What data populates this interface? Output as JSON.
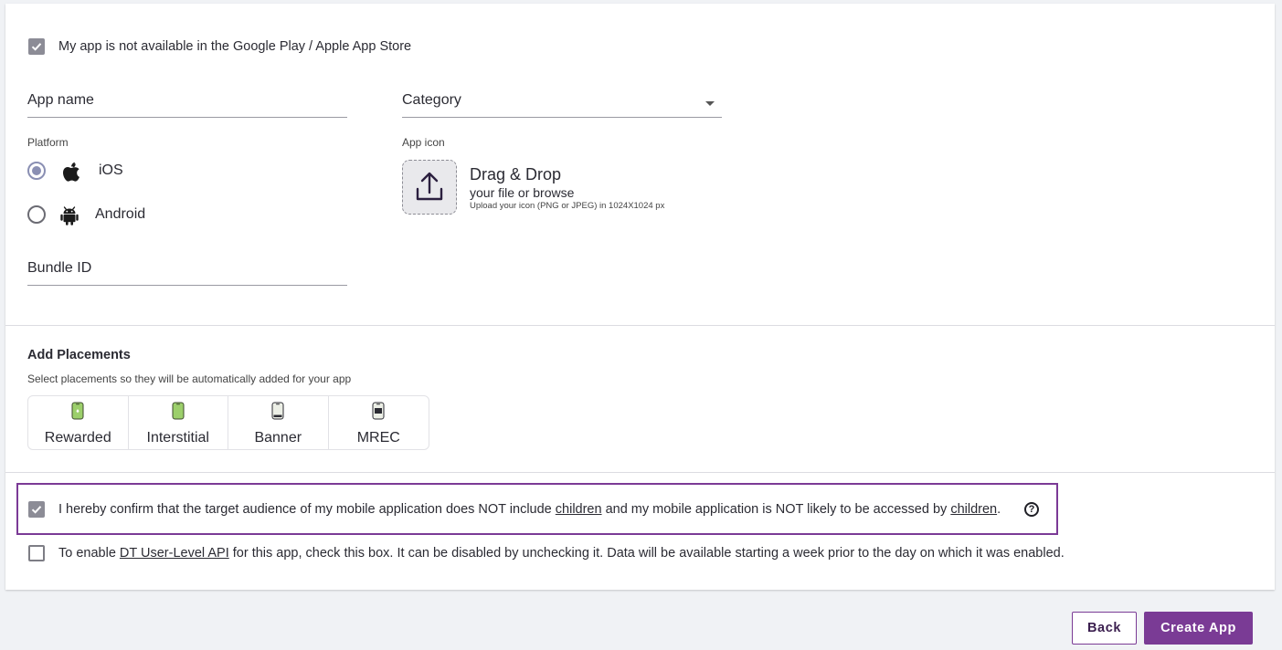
{
  "not_in_store": {
    "label": "My app is not available in the Google Play / Apple App Store",
    "checked": true
  },
  "form": {
    "app_name_label": "App name",
    "category_label": "Category",
    "platform_label": "Platform",
    "platforms": [
      {
        "label": "iOS",
        "icon": "apple-icon",
        "selected": true
      },
      {
        "label": "Android",
        "icon": "android-icon",
        "selected": false
      }
    ],
    "bundle_id_label": "Bundle ID"
  },
  "app_icon": {
    "label": "App icon",
    "title": "Drag & Drop",
    "subtitle": "your file or browse",
    "hint": "Upload your icon (PNG or JPEG) in 1024X1024 px"
  },
  "placements": {
    "title": "Add Placements",
    "description": "Select placements so they will be automatically added for your app",
    "items": [
      {
        "label": "Rewarded",
        "icon": "rewarded-phone-icon"
      },
      {
        "label": "Interstitial",
        "icon": "interstitial-phone-icon"
      },
      {
        "label": "Banner",
        "icon": "banner-phone-icon"
      },
      {
        "label": "MREC",
        "icon": "mrec-phone-icon"
      }
    ]
  },
  "coppa": {
    "checked": true,
    "part1": "I hereby confirm that the target audience of my mobile application does NOT include ",
    "link1": "children",
    "part2": " and my mobile application is NOT likely to be accessed by ",
    "link2": "children",
    "part3": ".",
    "help_icon": "question-circle-icon"
  },
  "user_level_api": {
    "checked": false,
    "part1": "To enable ",
    "link": "DT User-Level API",
    "part2": " for this app, check this box. It can be disabled by unchecking it. Data will be available starting a week prior to the day on which it was enabled."
  },
  "footer": {
    "back_label": "Back",
    "create_label": "Create App"
  },
  "colors": {
    "accent": "#7a3b95",
    "checkbox_checked": "#8c8c96",
    "radio_selected": "#8a8fb3",
    "page_background": "#f0f2f5"
  }
}
